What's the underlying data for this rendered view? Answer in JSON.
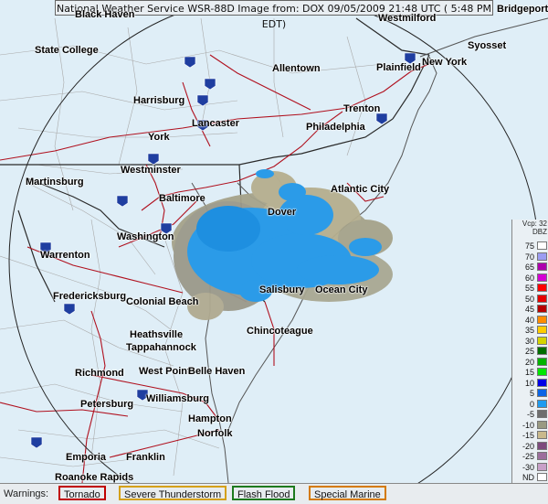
{
  "header": {
    "title": "National Weather Service WSR-88D Image from: DOX 09/05/2009 21:48 UTC ( 5:48 PM EDT)"
  },
  "cities": [
    {
      "name": "State College"
    },
    {
      "name": "Allentown"
    },
    {
      "name": "Harrisburg"
    },
    {
      "name": "Lancaster"
    },
    {
      "name": "York"
    },
    {
      "name": "Trenton"
    },
    {
      "name": "Philadelphia"
    },
    {
      "name": "Plainfield"
    },
    {
      "name": "New York"
    },
    {
      "name": "Syosset"
    },
    {
      "name": "Bridgeport"
    },
    {
      "name": "Westminster"
    },
    {
      "name": "Martinsburg"
    },
    {
      "name": "Baltimore"
    },
    {
      "name": "Dover"
    },
    {
      "name": "Atlantic City"
    },
    {
      "name": "Washington"
    },
    {
      "name": "Warrenton"
    },
    {
      "name": "Fredericksburg"
    },
    {
      "name": "Colonial Beach"
    },
    {
      "name": "Salisbury"
    },
    {
      "name": "Ocean City"
    },
    {
      "name": "Chincoteague"
    },
    {
      "name": "Heathsville"
    },
    {
      "name": "Tappahannock"
    },
    {
      "name": "Richmond"
    },
    {
      "name": "West Point"
    },
    {
      "name": "Belle Haven"
    },
    {
      "name": "Williamsburg"
    },
    {
      "name": "Petersburg"
    },
    {
      "name": "Hampton"
    },
    {
      "name": "Norfolk"
    },
    {
      "name": "Emporia"
    },
    {
      "name": "Franklin"
    },
    {
      "name": "Roanoke Rapids"
    },
    {
      "name": "Westmilford"
    },
    {
      "name": "Black Haven"
    }
  ],
  "legend": {
    "mode_label": "Vcp: 32",
    "unit_label": "DBZ",
    "entries": [
      {
        "label": "75",
        "color": "#ffffff"
      },
      {
        "label": "70",
        "color": "#9c9cf2"
      },
      {
        "label": "65",
        "color": "#ad00ad"
      },
      {
        "label": "60",
        "color": "#d400d4"
      },
      {
        "label": "55",
        "color": "#ff0000"
      },
      {
        "label": "50",
        "color": "#e60000"
      },
      {
        "label": "45",
        "color": "#b80000"
      },
      {
        "label": "40",
        "color": "#ff8c00"
      },
      {
        "label": "35",
        "color": "#ffcc00"
      },
      {
        "label": "30",
        "color": "#d4d400"
      },
      {
        "label": "25",
        "color": "#006e00"
      },
      {
        "label": "20",
        "color": "#00b400"
      },
      {
        "label": "15",
        "color": "#00e800"
      },
      {
        "label": "10",
        "color": "#0000e6"
      },
      {
        "label": "5",
        "color": "#0a64e6"
      },
      {
        "label": "0",
        "color": "#1e9bf0"
      },
      {
        "label": "-5",
        "color": "#6e6e6e"
      },
      {
        "label": "-10",
        "color": "#9a9a82"
      },
      {
        "label": "-15",
        "color": "#c9b98c"
      },
      {
        "label": "-20",
        "color": "#7d4b7d"
      },
      {
        "label": "-25",
        "color": "#9c6e9c"
      },
      {
        "label": "-30",
        "color": "#c8a0c8"
      },
      {
        "label": "ND",
        "color": "#ffffff"
      }
    ]
  },
  "warnings": {
    "label": "Warnings:",
    "items": [
      {
        "label": "Tornado",
        "color": "#c00000"
      },
      {
        "label": "Severe Thunderstorm",
        "color": "#d4a017"
      },
      {
        "label": "Flash Flood",
        "color": "#1e7a1e"
      },
      {
        "label": "Special Marine",
        "color": "#d47a00"
      }
    ]
  },
  "colors": {
    "land": "#dfeef7",
    "state_border": "#333333",
    "county_line": "#a8a8a8",
    "roads": "#b0101e",
    "radar_blue": "#2b9be8",
    "clutter": "#a6a38a"
  }
}
